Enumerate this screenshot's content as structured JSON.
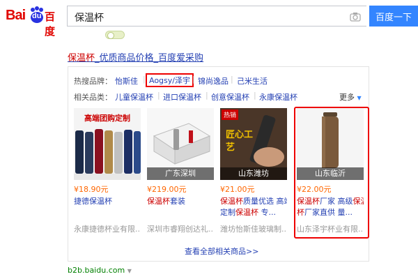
{
  "logo": {
    "latin": "Bai",
    "paw_text": "du",
    "chinese": "百度"
  },
  "search": {
    "query": "保温杯",
    "button_label": "百度一下"
  },
  "result": {
    "title_highlight": "保温杯",
    "title_rest": "_优质商品价格_百度爱采购",
    "hot_brands_label": "热搜品牌：",
    "hot_brands": [
      "怡斯佳",
      "Aogsy/泽宇",
      "锦尚逸品",
      "己米生活"
    ],
    "related_label": "相关品类：",
    "related": [
      "儿童保温杯",
      "进口保温杯",
      "创意保温杯",
      "永康保温杯"
    ],
    "more_label": "更多",
    "see_all": "查看全部相关商品>>",
    "domain": "b2b.baidu.com"
  },
  "products": [
    {
      "img_text": "高端团购定制",
      "caption": "",
      "price": "¥18.90元",
      "t1": "捷德保温杯",
      "t2": "",
      "seller": "永康捷德杯业有限..."
    },
    {
      "img_text": "",
      "caption": "广东深圳",
      "price": "¥219.00元",
      "t1": "保温杯套装",
      "t2": "",
      "seller": "深圳市睿翔创达礼..."
    },
    {
      "img_text": "匠心工艺",
      "badge": "热销",
      "caption": "山东潍坊",
      "price": "¥21.00元",
      "t1": "保温杯质量优选 高端",
      "t2": "定制保温杯 专...",
      "seller": "潍坊怡斯佳玻璃制..."
    },
    {
      "img_text": "",
      "caption": "山东临沂",
      "price": "¥22.00元",
      "t1": "保温杯厂家 高级保温",
      "t2": "杯厂家直供 量...",
      "seller": "山东泽宇杯业有限..."
    }
  ],
  "colors": {
    "accent": "#3385ff",
    "link": "#2440b3",
    "highlight_red": "#e00",
    "price": "#f60"
  }
}
